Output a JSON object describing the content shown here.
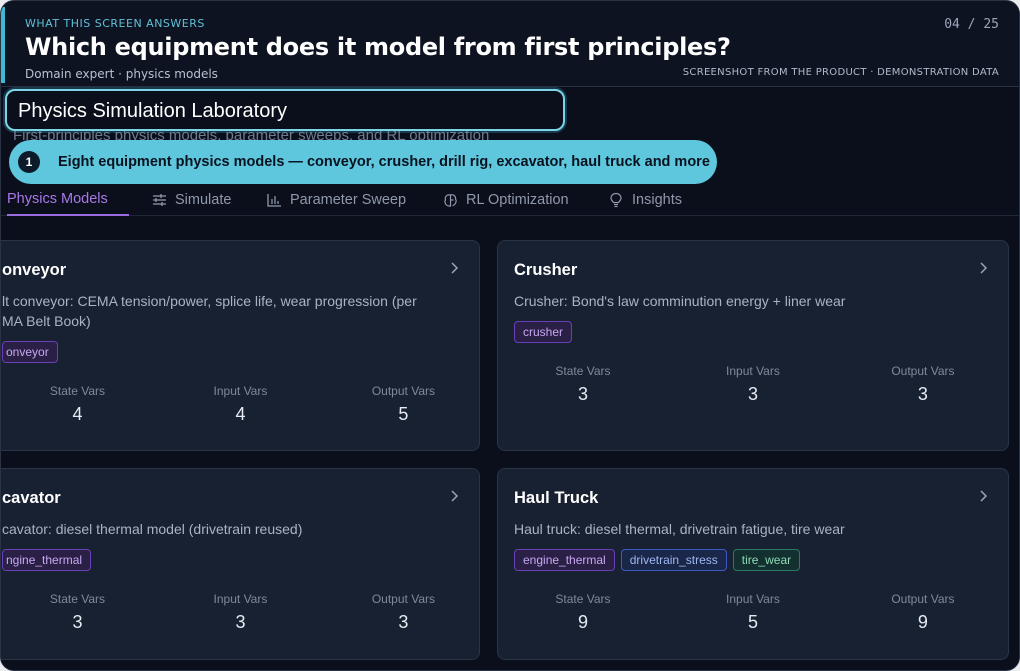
{
  "caption": {
    "eyebrow": "WHAT THIS SCREEN ANSWERS",
    "question": "Which equipment does it model from first principles?",
    "sub": "Domain expert · physics models",
    "counter": "04 / 25",
    "disclaimer": "SCREENSHOT FROM THE PRODUCT · DEMONSTRATION DATA",
    "accent_color": "#3fb9d3"
  },
  "page": {
    "title": "Physics Simulation Laboratory",
    "subtitle": "First-principles physics models, parameter sweeps, and RL optimization"
  },
  "callout": {
    "number": "1",
    "text": "Eight equipment physics models — conveyor, crusher, drill rig, excavator, haul truck and more"
  },
  "tabs": [
    {
      "label": "Physics Models",
      "icon": "atom-icon",
      "active": true
    },
    {
      "label": "Simulate",
      "icon": "sliders-icon"
    },
    {
      "label": "Parameter Sweep",
      "icon": "bar-chart-icon"
    },
    {
      "label": "RL Optimization",
      "icon": "brain-icon"
    },
    {
      "label": "Insights",
      "icon": "lightbulb-icon"
    }
  ],
  "cards": [
    {
      "name": "Conveyor",
      "name_visible": "onveyor",
      "desc_visible": "lt conveyor: CEMA tension/power, splice life, wear progression (per\nMA Belt Book)",
      "tags": [
        {
          "label": "onveyor",
          "color": "purple"
        }
      ],
      "stats": {
        "state_label": "State Vars",
        "state": "4",
        "input_label": "Input Vars",
        "input": "4",
        "output_label": "Output Vars",
        "output": "5"
      }
    },
    {
      "name_visible": "Crusher",
      "desc_visible": "Crusher: Bond's law comminution energy + liner wear",
      "tags": [
        {
          "label": "crusher",
          "color": "purple"
        }
      ],
      "stats": {
        "state_label": "State Vars",
        "state": "3",
        "input_label": "Input Vars",
        "input": "3",
        "output_label": "Output Vars",
        "output": "3"
      }
    },
    {
      "name_visible": "cavator",
      "desc_visible": "cavator: diesel thermal model (drivetrain reused)",
      "tags": [
        {
          "label": "ngine_thermal",
          "color": "purple"
        }
      ],
      "stats": {
        "state_label": "State Vars",
        "state": "3",
        "input_label": "Input Vars",
        "input": "3",
        "output_label": "Output Vars",
        "output": "3"
      }
    },
    {
      "name_visible": "Haul Truck",
      "desc_visible": "Haul truck: diesel thermal, drivetrain fatigue, tire wear",
      "tags": [
        {
          "label": "engine_thermal",
          "color": "purple"
        },
        {
          "label": "drivetrain_stress",
          "color": "blue"
        },
        {
          "label": "tire_wear",
          "color": "green"
        }
      ],
      "stats": {
        "state_label": "State Vars",
        "state": "9",
        "input_label": "Input Vars",
        "input": "5",
        "output_label": "Output Vars",
        "output": "9"
      }
    }
  ]
}
